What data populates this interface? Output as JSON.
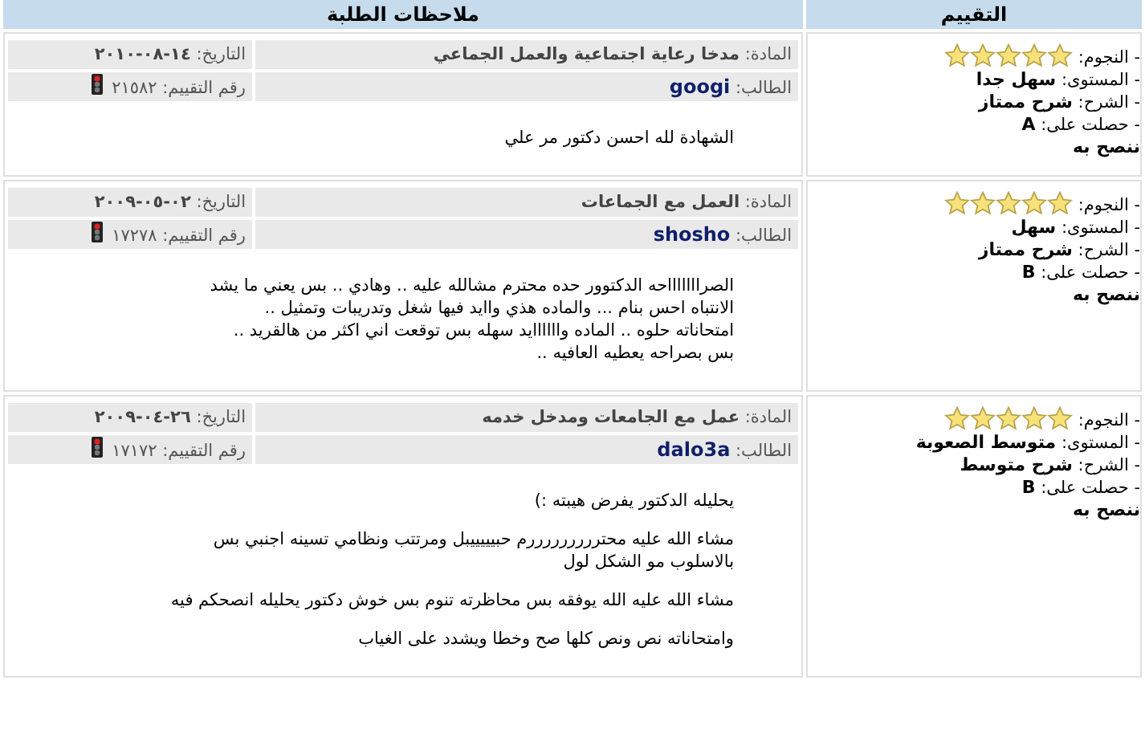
{
  "columns": [
    "التقييم",
    "ملاحظات الطلبة"
  ],
  "reviews": [
    {
      "rating": {
        "stars_label": "- النجوم:",
        "stars": 5,
        "level_label": "- المستوى:",
        "level": "سهل جدا",
        "explanation_label": "- الشرح:",
        "explanation": "شرح ممتاز",
        "grade_label": "- حصلت على:",
        "grade": "A",
        "recommend": "ننصح به"
      },
      "notes": {
        "subject_label": "المادة:",
        "subject": "مدخا رعاية اجتماعية والعمل الجماعي",
        "date_label": "التاريخ:",
        "date": "١٤-٠٨-٢٠١٠",
        "student_label": "الطالب:",
        "student": "googi",
        "rating_no_label": "رقم التقييم:",
        "rating_no": "٢١٥٨٢",
        "comment": [
          [
            "الشهادة لله احسن دكتور مر علي"
          ]
        ]
      }
    },
    {
      "rating": {
        "stars_label": "- النجوم:",
        "stars": 5,
        "level_label": "- المستوى:",
        "level": "سهل",
        "explanation_label": "- الشرح:",
        "explanation": "شرح ممتاز",
        "grade_label": "- حصلت على:",
        "grade": "B",
        "recommend": "ننصح به"
      },
      "notes": {
        "subject_label": "المادة:",
        "subject": "العمل مع الجماعات",
        "date_label": "التاريخ:",
        "date": "٠٢-٠٥-٢٠٠٩",
        "student_label": "الطالب:",
        "student": "shosho",
        "rating_no_label": "رقم التقييم:",
        "rating_no": "١٧٢٧٨",
        "comment": [
          [
            "الصراااااااحه الدكتوور حده محترم مشالله عليه .. وهادي .. بس يعني ما يشد",
            "الانتباه احس بنام ... والماده هذي واايد فيها شغل وتدريبات وتمثيل ..",
            "امتحاناته حلوه .. الماده واااااايد سهله بس توقعت اني اكثر من هالقريد ..",
            "بس بصراحه يعطيه العافيه .."
          ]
        ]
      }
    },
    {
      "rating": {
        "stars_label": "- النجوم:",
        "stars": 5,
        "level_label": "- المستوى:",
        "level": "متوسط الصعوبة",
        "explanation_label": "- الشرح:",
        "explanation": "شرح متوسط",
        "grade_label": "- حصلت على:",
        "grade": "B",
        "recommend": "ننصح به"
      },
      "notes": {
        "subject_label": "المادة:",
        "subject": "عمل مع الجامعات ومدخل خدمه",
        "date_label": "التاريخ:",
        "date": "٢٦-٠٤-٢٠٠٩",
        "student_label": "الطالب:",
        "student": "dalo3a",
        "rating_no_label": "رقم التقييم:",
        "rating_no": "١٧١٧٢",
        "comment": [
          [
            "يحليله الدكتور يفرض هيبته :)"
          ],
          [
            "مشاء الله عليه محترررررررررم حبيييييبل ومرتتب ونظامي تسينه اجنبي بس",
            "بالاسلوب مو الشكل لول"
          ],
          [
            "مشاء الله عليه الله يوفقه بس محاظرته تنوم بس خوش دكتور يحليله انصحكم فيه"
          ],
          [
            "وامتحاناته نص ونص كلها صح وخطا ويشدد على الغياب"
          ]
        ]
      }
    }
  ]
}
